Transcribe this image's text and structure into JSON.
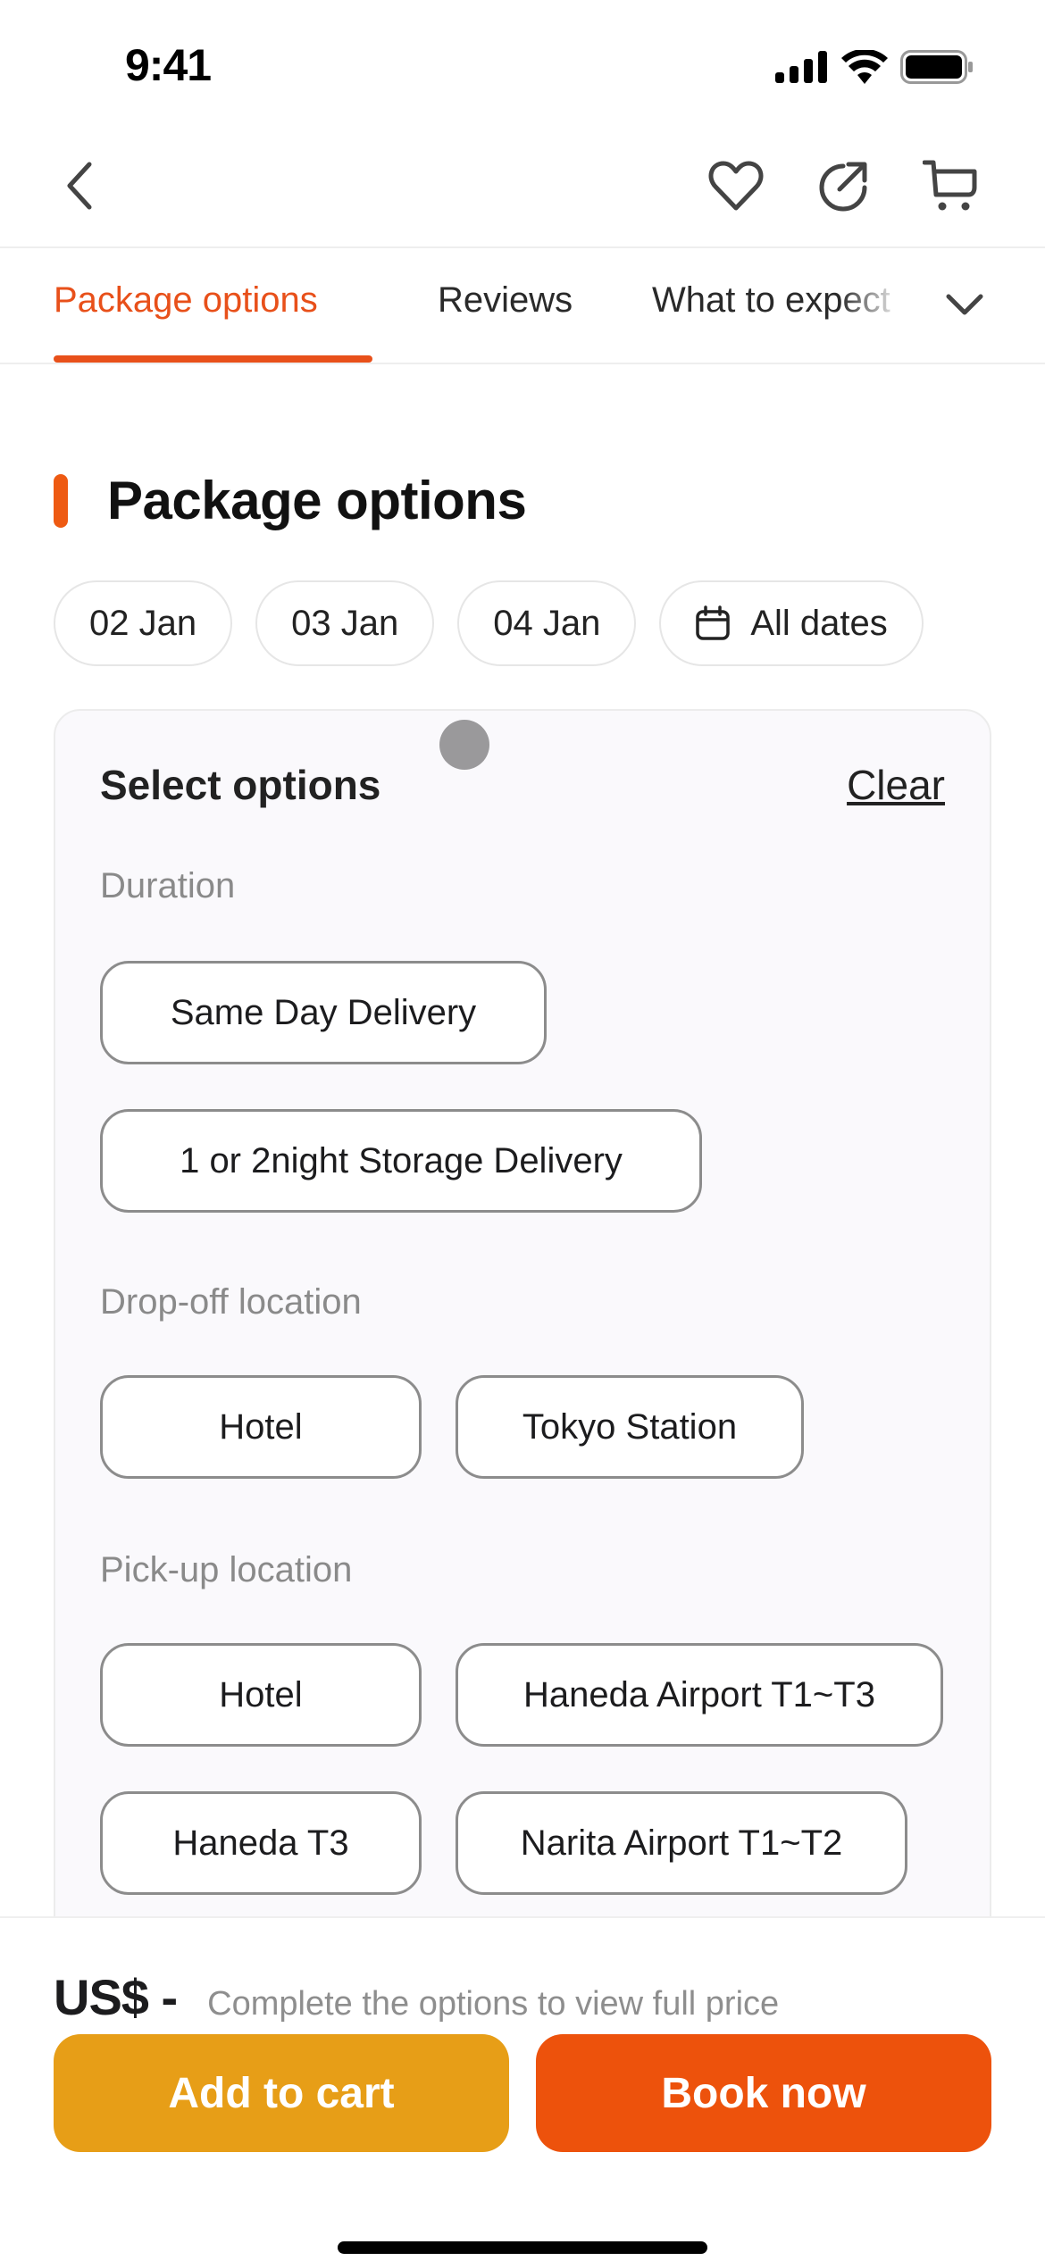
{
  "status_bar": {
    "time": "9:41"
  },
  "top_nav": {
    "icons": [
      "back-chevron-icon",
      "heart-icon",
      "share-icon",
      "cart-icon"
    ]
  },
  "tabs": {
    "items": [
      {
        "label": "Package options",
        "active": true
      },
      {
        "label": "Reviews",
        "active": false
      },
      {
        "label": "What to expect",
        "active": false
      }
    ],
    "more_icon": "chevron-down-icon"
  },
  "section": {
    "title": "Package options"
  },
  "date_chips": [
    {
      "label": "02 Jan"
    },
    {
      "label": "03 Jan"
    },
    {
      "label": "04 Jan"
    },
    {
      "label": "All dates",
      "icon": "calendar-icon"
    }
  ],
  "options": {
    "title": "Select options",
    "clear_label": "Clear",
    "groups": [
      {
        "label": "Duration",
        "choices": [
          "Same Day Delivery",
          "1 or 2night Storage Delivery"
        ]
      },
      {
        "label": "Drop-off location",
        "choices": [
          "Hotel",
          "Tokyo Station"
        ]
      },
      {
        "label": "Pick-up location",
        "choices": [
          "Hotel",
          "Haneda Airport T1~T3",
          "Haneda T3",
          "Narita Airport T1~T2"
        ]
      }
    ]
  },
  "bottom_bar": {
    "price": "US$ -",
    "price_note": "Complete the options to view full price",
    "add_to_cart_label": "Add to cart",
    "book_now_label": "Book now"
  },
  "colors": {
    "accent": "#e8501a",
    "add_to_cart": "#e79e17",
    "book_now": "#ed520c"
  }
}
